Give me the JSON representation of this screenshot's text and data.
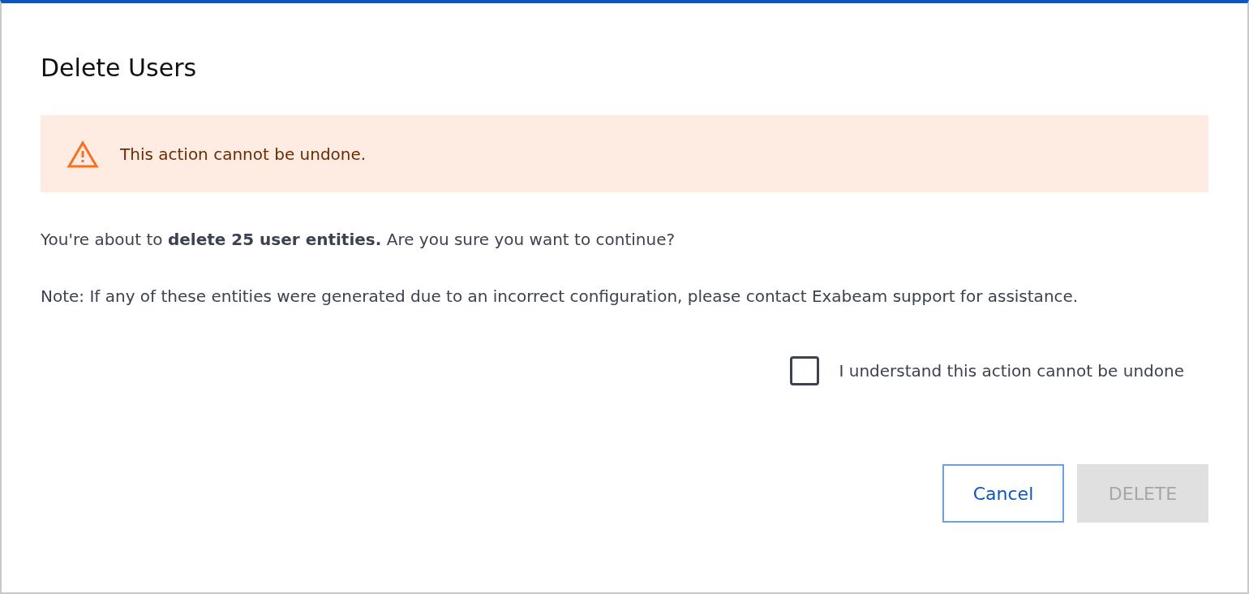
{
  "dialog": {
    "title": "Delete Users",
    "alert": {
      "kind": "warning",
      "text": "This action cannot be undone."
    },
    "message": "You're about to **delete 25 user entities.** Are you sure you want to continue?",
    "note": "Note: If any of these entities were generated due to an incorrect configuration, please contact Exabeam support for assistance.",
    "confirm": {
      "label": "I understand this action cannot be undone",
      "checked": false
    },
    "buttons": [
      {
        "label": "Cancel",
        "kind": "secondary",
        "disabled": false
      },
      {
        "label": "DELETE",
        "kind": "primary",
        "disabled": true
      }
    ]
  }
}
